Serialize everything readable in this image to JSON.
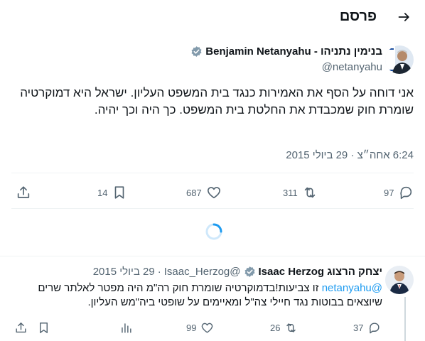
{
  "header": {
    "title": "פרסם",
    "back_icon": "arrow-right-icon"
  },
  "tweet": {
    "display_name": "Benjamin Netanyahu - בנימין נתניהו",
    "handle": "@netanyahu",
    "verified_color": "#829aab",
    "text": "אני דוחה על הסף את האמירות כנגד בית המשפט העליון. ישראל היא דמוקרטיה שומרת חוק שמכבדת את החלטת בית המשפט. כך היה וכך יהיה.",
    "timestamp": "6:24 אחה״צ · 29 ביולי 2015",
    "actions": {
      "replies": "97",
      "retweets": "311",
      "likes": "687",
      "bookmarks": "14"
    }
  },
  "reply": {
    "display_name": "יצחק הרצוג Isaac Herzog",
    "handle": "@Isaac_Herzog",
    "date": "29 ביולי 2015",
    "mention": "@netanyahu",
    "text": "זו צביעות!בדמוקרטיה שומרת חוק רה\"מ היה מפטר לאלתר שרים שיוצאים בבוטות נגד חיילי צה\"ל ומאיימים על שופטי ביה\"מש העליון.",
    "actions": {
      "replies": "37",
      "retweets": "26",
      "views": "99"
    }
  },
  "colors": {
    "accent": "#1d9bf0",
    "text": "#0f1419",
    "muted": "#536471",
    "divider": "#eff3f4"
  }
}
